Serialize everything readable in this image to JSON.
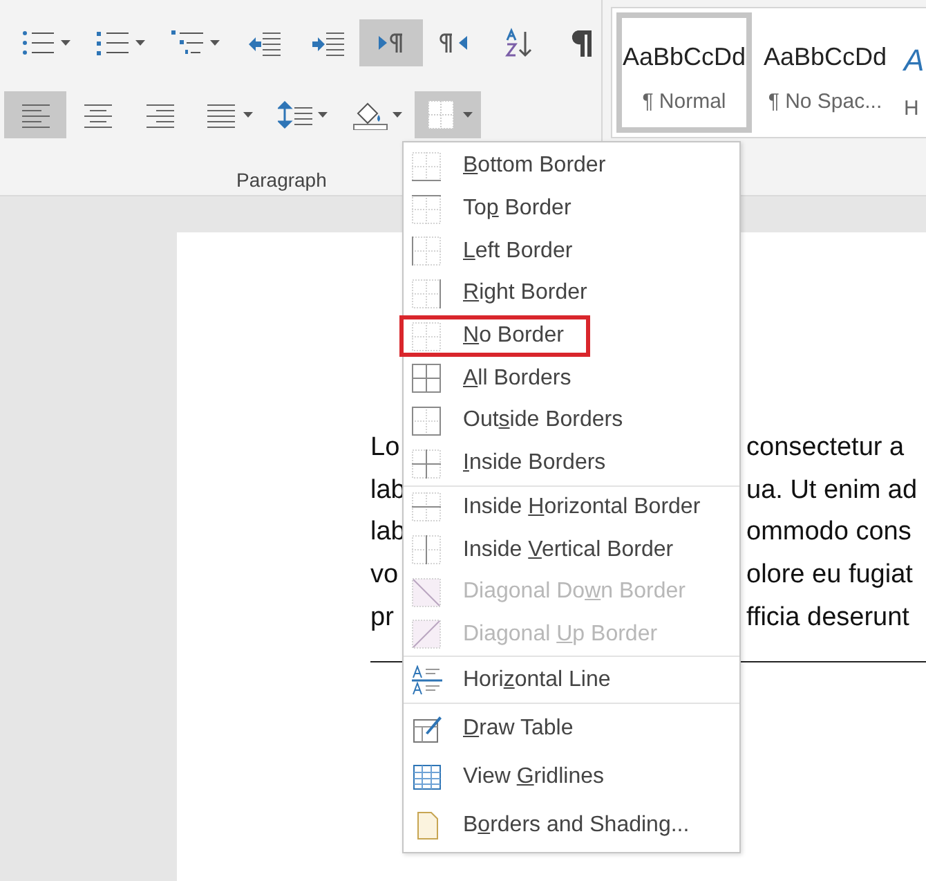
{
  "ribbon": {
    "row_1": [
      {
        "kind": "bullets",
        "dropdown": true,
        "selected": false
      },
      {
        "kind": "numbering",
        "dropdown": true,
        "selected": false
      },
      {
        "kind": "multilevel",
        "dropdown": true,
        "selected": false
      },
      {
        "kind": "outdent",
        "dropdown": false,
        "selected": false
      },
      {
        "kind": "indent",
        "dropdown": false,
        "selected": false
      },
      {
        "kind": "ltr",
        "dropdown": false,
        "selected": true
      },
      {
        "kind": "rtl",
        "dropdown": false,
        "selected": false
      },
      {
        "kind": "sort",
        "dropdown": false,
        "selected": false
      },
      {
        "kind": "pilcrow",
        "dropdown": false,
        "selected": false
      }
    ],
    "row_2": [
      {
        "kind": "align_left",
        "dropdown": false,
        "selected": true
      },
      {
        "kind": "align_center",
        "dropdown": false,
        "selected": false
      },
      {
        "kind": "align_right",
        "dropdown": false,
        "selected": false
      },
      {
        "kind": "justify",
        "dropdown": true,
        "selected": false
      },
      {
        "kind": "line_spacing",
        "dropdown": true,
        "selected": false
      },
      {
        "kind": "shading",
        "dropdown": true,
        "selected": false
      },
      {
        "kind": "borders",
        "dropdown": true,
        "selected": true
      }
    ],
    "group_label": "Paragraph",
    "styles": [
      {
        "sample": "AaBbCcDd",
        "name": "¶ Normal",
        "selected": true
      },
      {
        "sample": "AaBbCcDd",
        "name": "¶ No Spac...",
        "selected": false
      },
      {
        "sample": "A",
        "name": "H",
        "selected": false
      }
    ]
  },
  "document": {
    "lines": [
      {
        "left": "Lo",
        "right": "consectetur a"
      },
      {
        "left": "lab",
        "right": "ua. Ut enim ad"
      },
      {
        "left": "lab",
        "right": "ommodo cons"
      },
      {
        "left": "vo",
        "right": "olore eu fugiat"
      },
      {
        "left": "pr",
        "right": "fficia deserunt"
      }
    ]
  },
  "menu": {
    "groups": [
      [
        {
          "label": {
            "key": "B",
            "post": "ottom Border"
          },
          "kind": "bottom",
          "disabled": false,
          "highlighted": false
        },
        {
          "label": {
            "pre": "To",
            "key": "p",
            "post": " Border"
          },
          "kind": "top",
          "disabled": false,
          "highlighted": false
        },
        {
          "label": {
            "key": "L",
            "post": "eft Border"
          },
          "kind": "left",
          "disabled": false,
          "highlighted": false
        },
        {
          "label": {
            "key": "R",
            "post": "ight Border"
          },
          "kind": "right",
          "disabled": false,
          "highlighted": false
        },
        {
          "label": {
            "key": "N",
            "post": "o Border"
          },
          "kind": "none",
          "disabled": false,
          "highlighted": true
        },
        {
          "label": {
            "key": "A",
            "post": "ll Borders"
          },
          "kind": "all",
          "disabled": false,
          "highlighted": false
        },
        {
          "label": {
            "pre": "Out",
            "key": "s",
            "post": "ide Borders"
          },
          "kind": "outside",
          "disabled": false,
          "highlighted": false
        },
        {
          "label": {
            "key": "I",
            "post": "nside Borders"
          },
          "kind": "inside",
          "disabled": false,
          "highlighted": false
        }
      ],
      [
        {
          "label": {
            "pre": "Inside ",
            "key": "H",
            "post": "orizontal Border"
          },
          "kind": "inside_h",
          "disabled": false,
          "highlighted": false
        },
        {
          "label": {
            "pre": "Inside ",
            "key": "V",
            "post": "ertical Border"
          },
          "kind": "inside_v",
          "disabled": false,
          "highlighted": false
        },
        {
          "label": {
            "pre": "Diagonal Do",
            "key": "w",
            "post": "n Border"
          },
          "kind": "diag_down",
          "disabled": true,
          "highlighted": false
        },
        {
          "label": {
            "pre": "Diagonal ",
            "key": "U",
            "post": "p Border"
          },
          "kind": "diag_up",
          "disabled": true,
          "highlighted": false
        }
      ],
      [
        {
          "label": {
            "pre": "Hori",
            "key": "z",
            "post": "ontal Line"
          },
          "kind": "hline",
          "disabled": false,
          "highlighted": false
        }
      ],
      [
        {
          "label": {
            "key": "D",
            "post": "raw Table"
          },
          "kind": "draw",
          "disabled": false,
          "highlighted": false
        },
        {
          "label": {
            "pre": "View ",
            "key": "G",
            "post": "ridlines"
          },
          "kind": "grid",
          "disabled": false,
          "highlighted": false
        },
        {
          "label": {
            "pre": "B",
            "key": "o",
            "post": "rders and Shading..."
          },
          "kind": "shading",
          "disabled": false,
          "highlighted": false
        }
      ]
    ]
  }
}
